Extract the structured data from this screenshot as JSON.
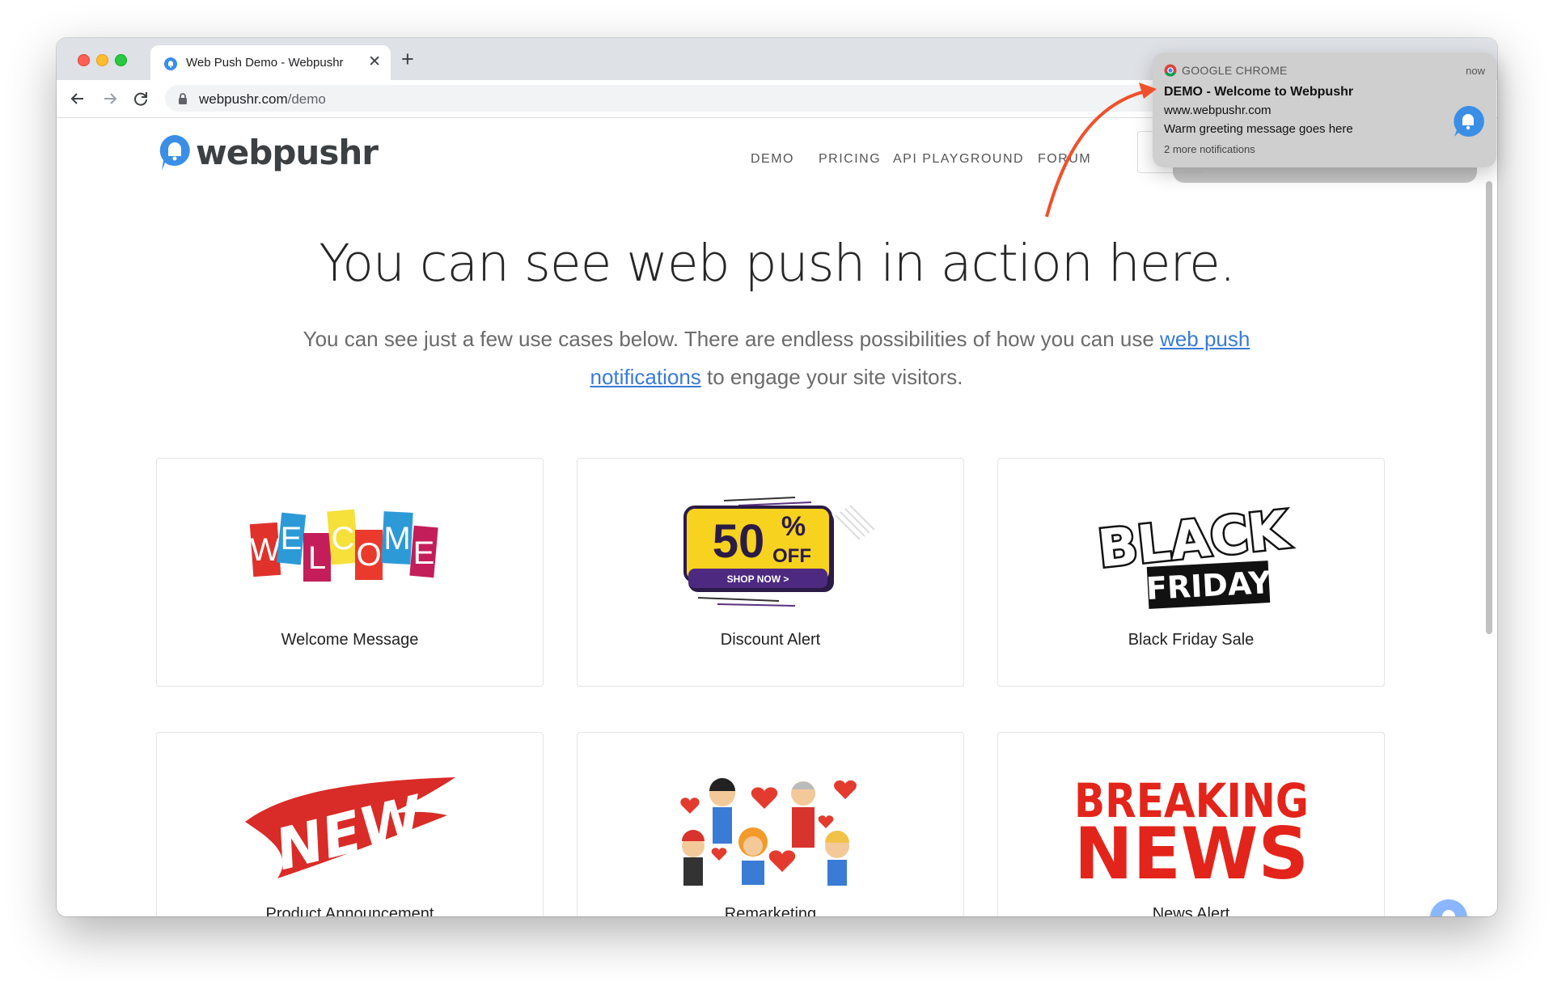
{
  "browser": {
    "tab": {
      "title": "Web Push Demo - Webpushr",
      "close": "✕"
    },
    "new_tab": "+",
    "url_host": "webpushr.com",
    "url_path": "/demo"
  },
  "site": {
    "logo_text": "webpushr",
    "nav": [
      "DEMO",
      "PRICING",
      "API PLAYGROUND",
      "FORUM"
    ],
    "headline": "You can see web push in action here.",
    "sub_before": "You can see just a few use cases below. There are endless possibilities of how you can use ",
    "sub_link": "web push notifications",
    "sub_after": " to engage your site visitors.",
    "cards": [
      {
        "label": "Welcome Message",
        "art": [
          "W",
          "E",
          "L",
          "C",
          "O",
          "M",
          "E"
        ]
      },
      {
        "label": "Discount Alert",
        "art_big": "50",
        "art_pct": "%",
        "art_off": "OFF",
        "art_cta": "SHOP NOW >"
      },
      {
        "label": "Black Friday Sale",
        "art_top": "BLACK",
        "art_bottom": "FRIDAY"
      },
      {
        "label": "Product Announcement",
        "art": "NEW"
      },
      {
        "label": "Remarketing"
      },
      {
        "label": "News Alert",
        "art_top": "BREAKING",
        "art_bottom": "NEWS"
      }
    ]
  },
  "notification": {
    "app": "GOOGLE CHROME",
    "time": "now",
    "title": "DEMO - Welcome to Webpushr",
    "site": "www.webpushr.com",
    "message": "Warm greeting message goes here",
    "more": "2 more notifications"
  },
  "colors": {
    "brand_blue": "#3a8ee6",
    "link": "#3a7bd5",
    "arrow": "#f0502a",
    "news_red": "#e3241b",
    "new_red": "#d92b27"
  }
}
